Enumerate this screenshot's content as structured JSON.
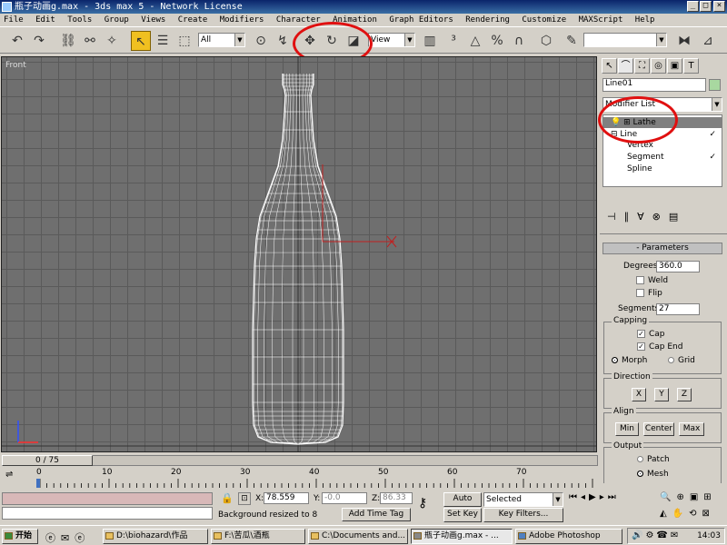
{
  "window": {
    "title": "瓶子动画g.max - 3ds max 5 - Network License"
  },
  "menu": [
    "File",
    "Edit",
    "Tools",
    "Group",
    "Views",
    "Create",
    "Modifiers",
    "Character",
    "Animation",
    "Graph Editors",
    "Rendering",
    "Customize",
    "MAXScript",
    "Help"
  ],
  "toolbar": {
    "selection_filter": "All",
    "ref_coord": "View"
  },
  "viewport": {
    "label": "Front"
  },
  "command_panel": {
    "object_name": "Line01",
    "modifier_list": "Modifier List",
    "stack": [
      "Lathe",
      "Line",
      "Vertex",
      "Segment",
      "Spline"
    ],
    "parameters": {
      "title": "Parameters",
      "degrees_label": "Degrees:",
      "degrees": "360.0",
      "weld": "Weld",
      "flip": "Flip",
      "segments_label": "Segments:",
      "segments": "27",
      "capping": "Capping",
      "cap_start": "Cap",
      "cap_end": "Cap End",
      "morph": "Morph",
      "grid": "Grid",
      "direction": "Direction",
      "x": "X",
      "y": "Y",
      "z": "Z",
      "align": "Align",
      "min": "Min",
      "center": "Center",
      "max": "Max",
      "output": "Output",
      "patch": "Patch",
      "mesh": "Mesh"
    }
  },
  "timeline": {
    "frame": "0 / 75",
    "ticks": [
      "0",
      "10",
      "20",
      "30",
      "40",
      "50",
      "60",
      "70"
    ]
  },
  "status": {
    "prompt": "Background resized to 8",
    "x_label": "X:",
    "x": "78.559",
    "y_label": "Y:",
    "y": "-0.0",
    "z_label": "Z:",
    "z": "86.33",
    "add_time_tag": "Add Time Tag",
    "auto_key": "Auto Key",
    "set_key": "Set Key",
    "key_mode": "Selected",
    "key_filters": "Key Filters..."
  },
  "taskbar": {
    "start": "开始",
    "tasks": [
      "D:\\biohazard\\作品",
      "F:\\苦瓜\\酒瓶",
      "C:\\Documents and...",
      "瓶子动画g.max - ...",
      "Adobe Photoshop"
    ],
    "clock": "14:03"
  },
  "colors": {
    "highlight_ring": "#e01010",
    "title_bar": "#0a246a",
    "viewport_bg": "#6f6f6f",
    "wireframe": "#ffffff",
    "active_modifier": "#808080"
  },
  "icons": [
    "undo-icon",
    "redo-icon",
    "select-link-icon",
    "unlink-icon",
    "bind-space-warp-icon",
    "select-object-icon",
    "select-by-name-icon",
    "region-select-icon",
    "select-move-icon",
    "select-rotate-icon",
    "select-scale-icon",
    "mirror-icon",
    "align-icon",
    "create-tab-icon",
    "modify-tab-icon",
    "hierarchy-tab-icon",
    "motion-tab-icon",
    "display-tab-icon",
    "utilities-tab-icon",
    "key-icon",
    "play-icon"
  ]
}
